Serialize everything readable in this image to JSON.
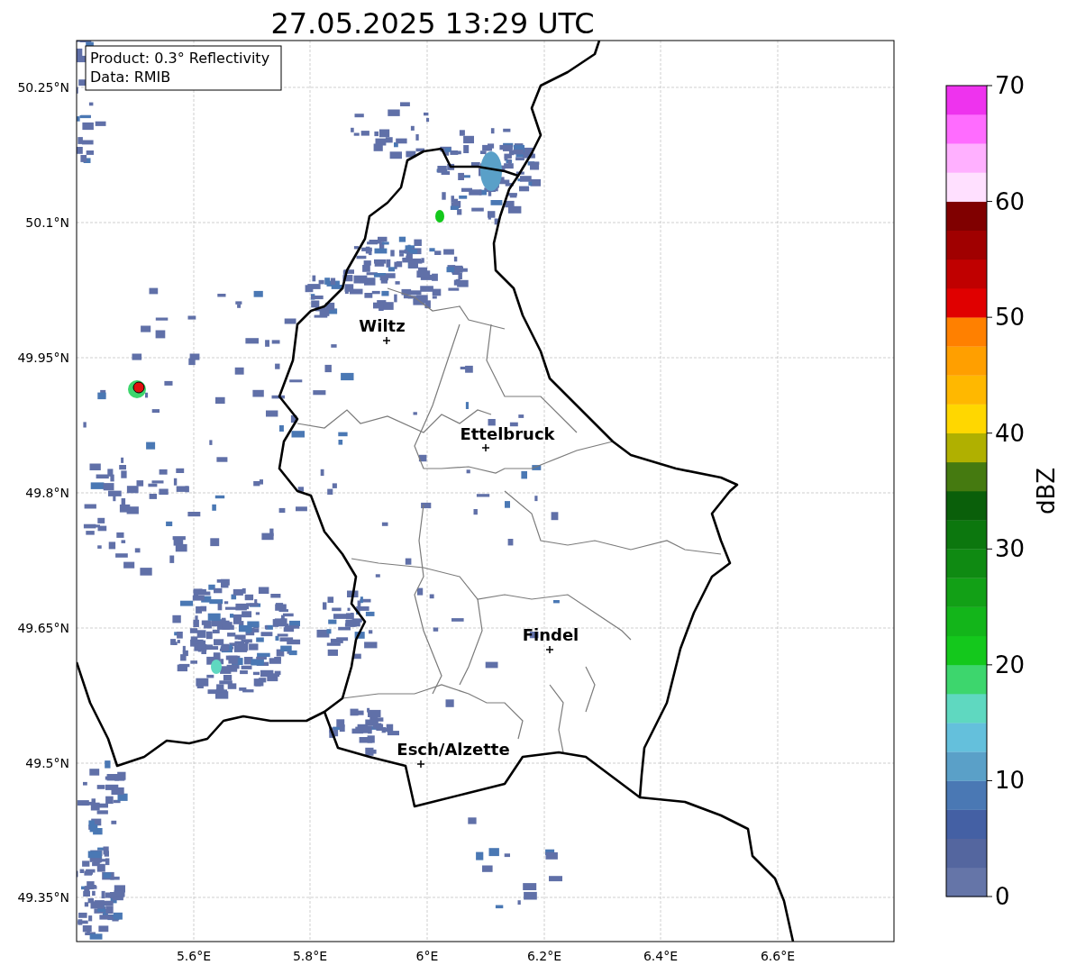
{
  "title": "27.05.2025 13:29 UTC",
  "legend": [
    "Product: 0.3° Reflectivity",
    "Data: RMIB"
  ],
  "x_ticks": [
    "5.6°E",
    "5.8°E",
    "6°E",
    "6.2°E",
    "6.4°E",
    "6.6°E"
  ],
  "y_ticks": [
    "50.25°N",
    "50.1°N",
    "49.95°N",
    "49.8°N",
    "49.65°N",
    "49.5°N",
    "49.35°N"
  ],
  "cities": [
    {
      "name": "Wiltz"
    },
    {
      "name": "Ettelbruck"
    },
    {
      "name": "Findel"
    },
    {
      "name": "Esch/Alzette"
    }
  ],
  "colorbar": {
    "label": "dBZ",
    "ticks": [
      "70",
      "60",
      "50",
      "40",
      "30",
      "20",
      "10",
      "0"
    ],
    "bins": [
      {
        "color": "#6575a8"
      },
      {
        "color": "#54669f"
      },
      {
        "color": "#4460a4"
      },
      {
        "color": "#4a78b4"
      },
      {
        "color": "#5aa0c8"
      },
      {
        "color": "#64c0dc"
      },
      {
        "color": "#5fd8c0"
      },
      {
        "color": "#3dd66d"
      },
      {
        "color": "#14c81c"
      },
      {
        "color": "#13b51a"
      },
      {
        "color": "#12a016"
      },
      {
        "color": "#0f8a12"
      },
      {
        "color": "#0c770e"
      },
      {
        "color": "#0a5f0a"
      },
      {
        "color": "#457a10"
      },
      {
        "color": "#b0b000"
      },
      {
        "color": "#ffd700"
      },
      {
        "color": "#ffb800"
      },
      {
        "color": "#ff9f00"
      },
      {
        "color": "#ff8000"
      },
      {
        "color": "#e00000"
      },
      {
        "color": "#c00000"
      },
      {
        "color": "#a00000"
      },
      {
        "color": "#800000"
      },
      {
        "color": "#ffe0ff"
      },
      {
        "color": "#ffb0ff"
      },
      {
        "color": "#ff6cff"
      },
      {
        "color": "#ee33ee"
      }
    ]
  }
}
